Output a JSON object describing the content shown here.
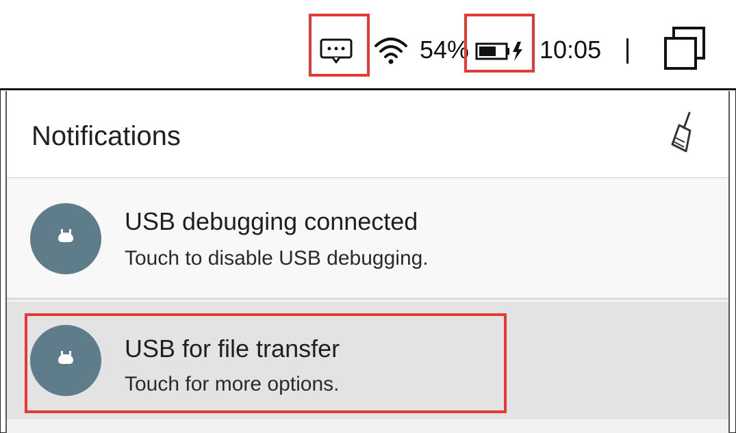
{
  "status_bar": {
    "battery_percent": "54%",
    "time": "10:05",
    "icons": [
      "message-icon",
      "wifi-icon",
      "battery-charging-icon",
      "recent-apps-icon"
    ]
  },
  "notifications_panel": {
    "title": "Notifications",
    "clear_icon": "broom-icon",
    "items": [
      {
        "title": "USB debugging connected",
        "text": "Touch to disable USB debugging.",
        "icon": "android-icon"
      },
      {
        "title": "USB for file transfer",
        "text": "Touch for more options.",
        "icon": "android-icon"
      }
    ]
  },
  "colors": {
    "highlight": "#e53935",
    "avatar": "#5f7c8a"
  }
}
